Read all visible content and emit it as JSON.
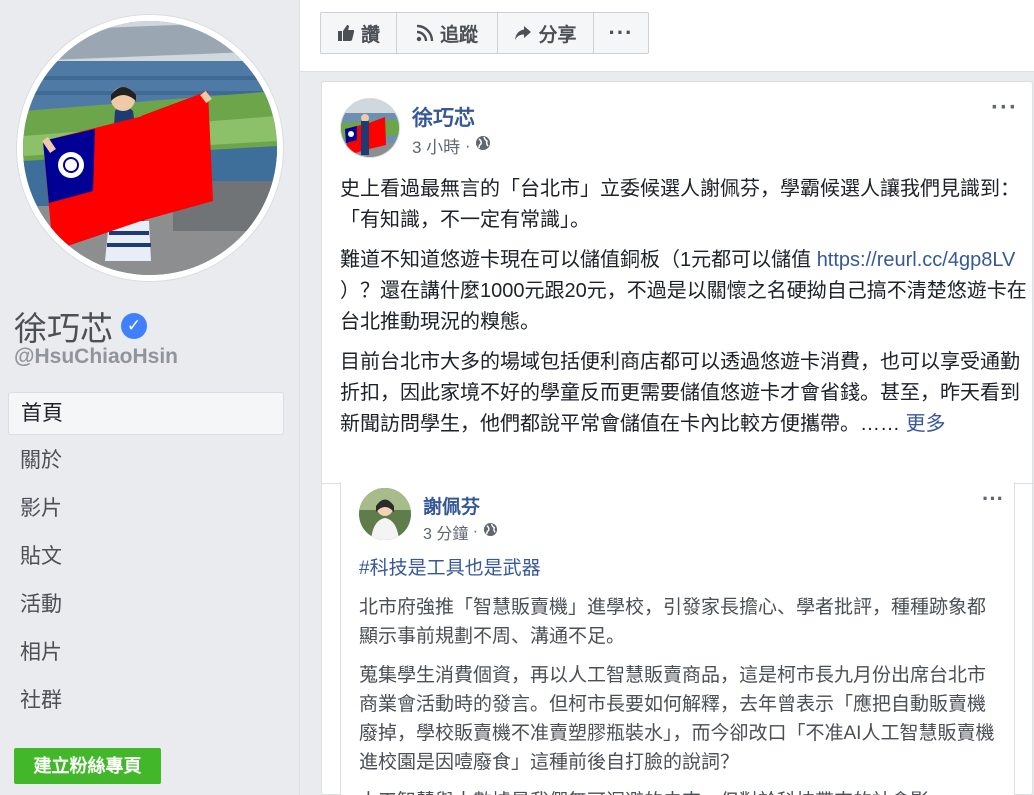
{
  "sidebar": {
    "page_name": "徐巧芯",
    "handle": "@HsuChiaoHsin",
    "nav": [
      {
        "label": "首頁"
      },
      {
        "label": "關於"
      },
      {
        "label": "影片"
      },
      {
        "label": "貼文"
      },
      {
        "label": "活動"
      },
      {
        "label": "相片"
      },
      {
        "label": "社群"
      }
    ],
    "create_page_label": "建立粉絲專頁"
  },
  "actions": {
    "like": "讚",
    "follow": "追蹤",
    "share": "分享",
    "more": "···"
  },
  "post": {
    "author": "徐巧芯",
    "time": "3 小時",
    "more": "···",
    "para1": "史上看過最無言的「台北市」立委候選人謝佩芬，學霸候選人讓我們見識到：「有知識，不一定有常識」。",
    "para2_before": "難道不知道悠遊卡現在可以儲值銅板（1元都可以儲值 ",
    "para2_link": "https://reurl.cc/4gp8LV",
    "para2_after": " ）？還在講什麼1000元跟20元，不過是以關懷之名硬拗自己搞不清楚悠遊卡在台北推動現況的糗態。",
    "para3": "目前台北市大多的場域包括便利商店都可以透過悠遊卡消費，也可以享受通勤折扣，因此家境不好的學童反而更需要儲值悠遊卡才會省錢。甚至，昨天看到新聞訪問學生，他們都說平常會儲值在卡內比較方便攜帶。……",
    "see_more": "更多"
  },
  "shared_post": {
    "author": "謝佩芬",
    "time": "3 分鐘",
    "more": "···",
    "hashtag": "#科技是工具也是武器",
    "para1": "北市府強推「智慧販賣機」進學校，引發家長擔心、學者批評，種種跡象都顯示事前規劃不周、溝通不足。",
    "para2": "蒐集學生消費個資，再以人工智慧販賣商品，這是柯市長九月份出席台北市商業會活動時的發言。但柯市長要如何解釋，去年曾表示「應把自動販賣機廢掉，學校販賣機不准賣塑膠瓶裝水」，而今卻改口「不准AI人工智慧販賣機進校園是因噎廢食」這種前後自打臉的說詞？",
    "para3": "人工智慧與大數據是我們無可迴避的未來，但對於科技帶來的社會影"
  },
  "colors": {
    "link": "#365899",
    "verified": "#4080ff",
    "create_button": "#42b72a",
    "flag_red": "#fe0000",
    "flag_blue": "#000095"
  }
}
